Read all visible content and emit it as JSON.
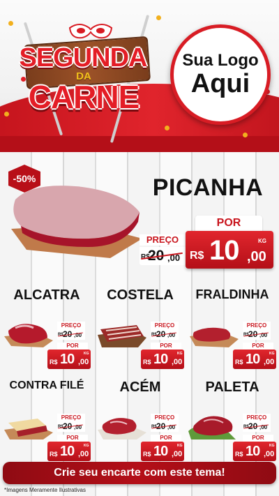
{
  "header": {
    "title_line1": "SEGUNDA",
    "title_line2": "DA",
    "title_line3": "CARNE",
    "logo_line1": "Sua Logo",
    "logo_line2": "Aqui"
  },
  "hero": {
    "discount": "-50%",
    "name": "PICANHA",
    "preco_label": "PREÇO",
    "old_currency": "R$",
    "old_int": "20",
    "old_cents": ",00",
    "por_label": "POR",
    "currency": "R$",
    "price_int": "10",
    "price_cents": ",00",
    "unit": "KG"
  },
  "products": [
    {
      "name": "ALCATRA",
      "preco_label": "PREÇO",
      "old_currency": "R$",
      "old_int": "20",
      "old_cents": ",00",
      "por_label": "POR",
      "currency": "R$",
      "price_int": "10",
      "price_cents": ",00",
      "unit": "KG"
    },
    {
      "name": "COSTELA",
      "preco_label": "PREÇO",
      "old_currency": "R$",
      "old_int": "20",
      "old_cents": ",00",
      "por_label": "POR",
      "currency": "R$",
      "price_int": "10",
      "price_cents": ",00",
      "unit": "KG"
    },
    {
      "name": "FRALDINHA",
      "preco_label": "PREÇO",
      "old_currency": "R$",
      "old_int": "20",
      "old_cents": ",00",
      "por_label": "POR",
      "currency": "R$",
      "price_int": "10",
      "price_cents": ",00",
      "unit": "KG"
    },
    {
      "name": "CONTRA FILÉ",
      "preco_label": "PREÇO",
      "old_currency": "R$",
      "old_int": "20",
      "old_cents": ",00",
      "por_label": "POR",
      "currency": "R$",
      "price_int": "10",
      "price_cents": ",00",
      "unit": "KG"
    },
    {
      "name": "ACÉM",
      "preco_label": "PREÇO",
      "old_currency": "R$",
      "old_int": "20",
      "old_cents": ",00",
      "por_label": "POR",
      "currency": "R$",
      "price_int": "10",
      "price_cents": ",00",
      "unit": "KG"
    },
    {
      "name": "PALETA",
      "preco_label": "PREÇO",
      "old_currency": "R$",
      "old_int": "20",
      "old_cents": ",00",
      "por_label": "POR",
      "currency": "R$",
      "price_int": "10",
      "price_cents": ",00",
      "unit": "KG"
    }
  ],
  "footer": {
    "cta": "Crie seu encarte com este tema!",
    "note": "*Imagens Meramente Ilustrativas"
  },
  "colors": {
    "brand_red": "#d81c24",
    "dark_red": "#b40f18",
    "gold": "#f3c21c"
  },
  "icons": [
    "carnival-mask-icon",
    "skewer-icon",
    "meat-icon"
  ]
}
